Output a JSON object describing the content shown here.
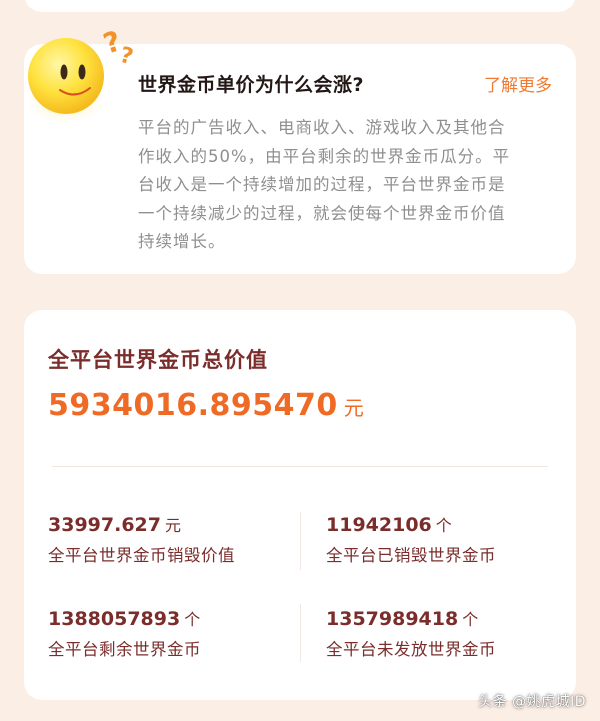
{
  "colors": {
    "page_bg": "#fbeee5",
    "card_bg": "#ffffff",
    "accent_orange": "#ee6a25",
    "link_orange": "#f07a31",
    "dark_red": "#7a2d2b",
    "body_gray": "#8f8f8f"
  },
  "mascot": {
    "icon": "smiley-face-icon",
    "question_marks": [
      "?",
      "?"
    ]
  },
  "info_card": {
    "title": "世界金币单价为什么会涨?",
    "link": "了解更多",
    "lines": [
      "平台的广告收入、电商收入、游戏收入及其他合",
      "作收入的50%，由平台剩余的世界金币瓜分。平",
      "台收入是一个持续增加的过程，平台世界金币是",
      "一个持续减少的过程，就会使每个世界金币价值",
      "持续增长。"
    ]
  },
  "total": {
    "label": "全平台世界金币总价值",
    "value": "5934016.895470",
    "unit": "元"
  },
  "stats": [
    {
      "value": "33997.627",
      "unit": "元",
      "label": "全平台世界金币销毁价值"
    },
    {
      "value": "11942106",
      "unit": "个",
      "label": "全平台已销毁世界金币"
    },
    {
      "value": "1388057893",
      "unit": "个",
      "label": "全平台剩余世界金币"
    },
    {
      "value": "1357989418",
      "unit": "个",
      "label": "全平台未发放世界金币"
    }
  ],
  "watermark": "头条 @姚虎城ID"
}
